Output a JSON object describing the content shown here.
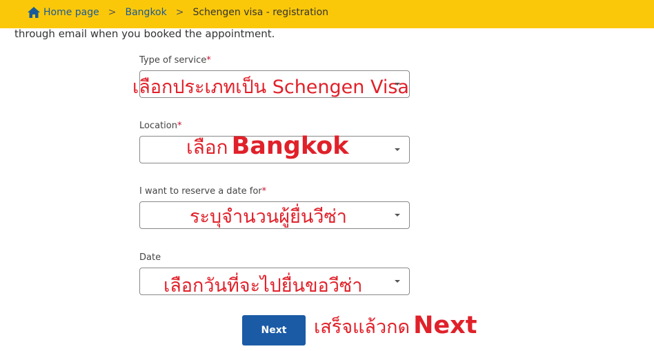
{
  "breadcrumb": {
    "home": "Home page",
    "separator": ">",
    "city": "Bangkok",
    "current": "Schengen visa - registration"
  },
  "intro_text": "through email when you booked the appointment.",
  "form": {
    "required_mark": "*",
    "service_label": "Type of service",
    "location_label": "Location",
    "reserve_label": "I want to reserve a date for",
    "date_label": "Date",
    "next_label": "Next"
  },
  "annotations": {
    "service": "เลือกประเภทเป็น Schengen Visa",
    "location_prefix": "เลือก",
    "location_bold": "Bangkok",
    "reserve": "ระบุจำนวนผู้ยื่นวีซ่า",
    "date": "เลือกวันที่จะไปยื่นขอวีซ่า",
    "next_prefix": "เสร็จแล้วกด",
    "next_bold": "Next"
  },
  "colors": {
    "topbar": "#fbc809",
    "link": "#1a5a99",
    "button": "#1b5ba6",
    "annotation": "#e0212a"
  }
}
